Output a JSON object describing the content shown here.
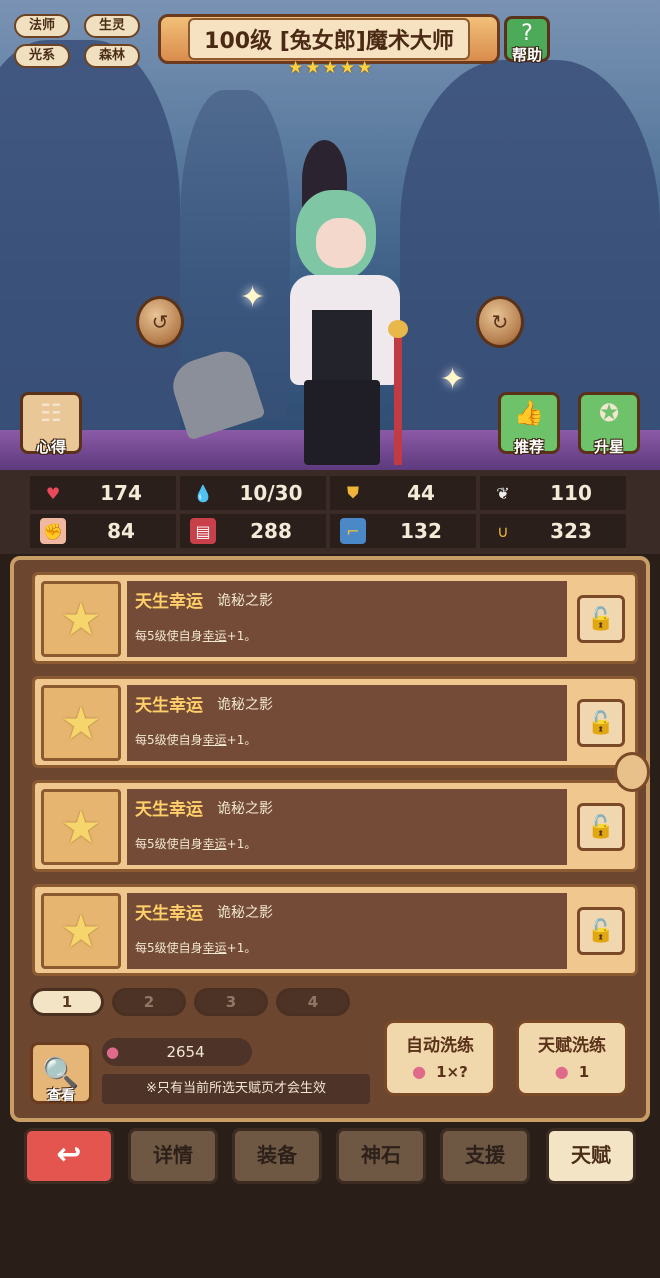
{
  "tags": [
    "法师",
    "生灵",
    "光系",
    "森林"
  ],
  "hero": {
    "title": "100级 [兔女郎]魔术大师",
    "stars": 5
  },
  "buttons": {
    "help": "帮助",
    "xinde": "心得",
    "tuijian": "推荐",
    "shengxing": "升星"
  },
  "stats": [
    {
      "icon": "heart-icon",
      "value": "174"
    },
    {
      "icon": "mana-drop-icon",
      "value": "10/30"
    },
    {
      "icon": "shield-icon",
      "value": "44"
    },
    {
      "icon": "wing-icon",
      "value": "110"
    },
    {
      "icon": "fist-icon",
      "value": "84"
    },
    {
      "icon": "book-icon",
      "value": "288"
    },
    {
      "icon": "boot-icon",
      "value": "132"
    },
    {
      "icon": "horseshoe-icon",
      "value": "323"
    }
  ],
  "talents": [
    {
      "name": "天生幸运",
      "source": "诡秘之影",
      "desc_prefix": "每5级使自身",
      "desc_link": "幸运",
      "desc_suffix": "+1。"
    },
    {
      "name": "天生幸运",
      "source": "诡秘之影",
      "desc_prefix": "每5级使自身",
      "desc_link": "幸运",
      "desc_suffix": "+1。"
    },
    {
      "name": "天生幸运",
      "source": "诡秘之影",
      "desc_prefix": "每5级使自身",
      "desc_link": "幸运",
      "desc_suffix": "+1。"
    },
    {
      "name": "天生幸运",
      "source": "诡秘之影",
      "desc_prefix": "每5级使自身",
      "desc_link": "幸运",
      "desc_suffix": "+1。"
    }
  ],
  "pages": [
    "1",
    "2",
    "3",
    "4"
  ],
  "active_page": "1",
  "view_label": "查看",
  "currency": "2654",
  "notice": "※只有当前所选天赋页才会生效",
  "auto_wash": {
    "label": "自动洗练",
    "cost": "1×?"
  },
  "talent_wash": {
    "label": "天赋洗练",
    "cost": "1"
  },
  "nav": [
    "详情",
    "装备",
    "神石",
    "支援",
    "天赋"
  ],
  "active_nav": "天赋"
}
